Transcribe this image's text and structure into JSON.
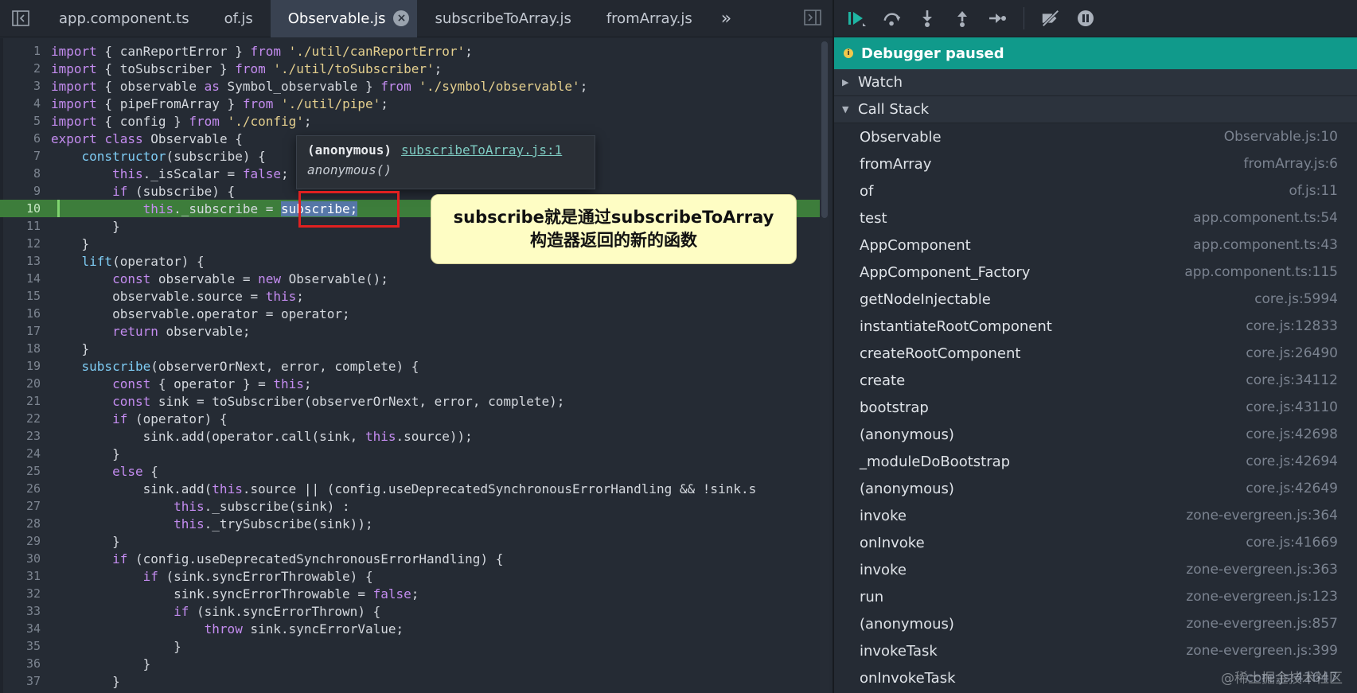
{
  "tabs": {
    "items": [
      "app.component.ts",
      "of.js",
      "Observable.js",
      "subscribeToArray.js",
      "fromArray.js"
    ],
    "active_index": 2,
    "close_glyph": "×",
    "more_glyph": "»"
  },
  "code": {
    "paused_line": 10,
    "lines": [
      {
        "n": "1",
        "html": "<span class=\"k\">import</span> { canReportError } <span class=\"k\">from</span> <span class=\"s\">'./util/canReportError'</span>;"
      },
      {
        "n": "2",
        "html": "<span class=\"k\">import</span> { toSubscriber } <span class=\"k\">from</span> <span class=\"s\">'./util/toSubscriber'</span>;"
      },
      {
        "n": "3",
        "html": "<span class=\"k\">import</span> { observable <span class=\"k\">as</span> Symbol_observable } <span class=\"k\">from</span> <span class=\"s\">'./symbol/observable'</span>;"
      },
      {
        "n": "4",
        "html": "<span class=\"k\">import</span> { pipeFromArray } <span class=\"k\">from</span> <span class=\"s\">'./util/pipe'</span>;"
      },
      {
        "n": "5",
        "html": "<span class=\"k\">import</span> { config } <span class=\"k\">from</span> <span class=\"s\">'./config'</span>;"
      },
      {
        "n": "6",
        "html": "<span class=\"k\">export</span> <span class=\"k\">class</span> Observable {"
      },
      {
        "n": "7",
        "html": "    <span class=\"p\">constructor</span>(subscribe) {"
      },
      {
        "n": "8",
        "html": "        <span class=\"k\">this</span>._isScalar = <span class=\"k\">false</span>;"
      },
      {
        "n": "9",
        "html": "        <span class=\"k\">if</span> (subscribe) {"
      },
      {
        "n": "10",
        "html": "            <span class=\"k\">this</span>._subscribe = <span class=\"hl\">subscribe;</span>"
      },
      {
        "n": "11",
        "html": "        }"
      },
      {
        "n": "12",
        "html": "    }"
      },
      {
        "n": "13",
        "html": "    <span class=\"p\">lift</span>(operator) {"
      },
      {
        "n": "14",
        "html": "        <span class=\"k\">const</span> observable = <span class=\"k\">new</span> Observable();"
      },
      {
        "n": "15",
        "html": "        observable.source = <span class=\"k\">this</span>;"
      },
      {
        "n": "16",
        "html": "        observable.operator = operator;"
      },
      {
        "n": "17",
        "html": "        <span class=\"k\">return</span> observable;"
      },
      {
        "n": "18",
        "html": "    }"
      },
      {
        "n": "19",
        "html": "    <span class=\"p\">subscribe</span>(observerOrNext, error, complete) {"
      },
      {
        "n": "20",
        "html": "        <span class=\"k\">const</span> { operator } = <span class=\"k\">this</span>;"
      },
      {
        "n": "21",
        "html": "        <span class=\"k\">const</span> sink = toSubscriber(observerOrNext, error, complete);"
      },
      {
        "n": "22",
        "html": "        <span class=\"k\">if</span> (operator) {"
      },
      {
        "n": "23",
        "html": "            sink.add(operator.call(sink, <span class=\"k\">this</span>.source));"
      },
      {
        "n": "24",
        "html": "        }"
      },
      {
        "n": "25",
        "html": "        <span class=\"k\">else</span> {"
      },
      {
        "n": "26",
        "html": "            sink.add(<span class=\"k\">this</span>.source || (config.useDeprecatedSynchronousErrorHandling &amp;&amp; !sink.s"
      },
      {
        "n": "27",
        "html": "                <span class=\"k\">this</span>._subscribe(sink) :"
      },
      {
        "n": "28",
        "html": "                <span class=\"k\">this</span>._trySubscribe(sink));"
      },
      {
        "n": "29",
        "html": "        }"
      },
      {
        "n": "30",
        "html": "        <span class=\"k\">if</span> (config.useDeprecatedSynchronousErrorHandling) {"
      },
      {
        "n": "31",
        "html": "            <span class=\"k\">if</span> (sink.syncErrorThrowable) {"
      },
      {
        "n": "32",
        "html": "                sink.syncErrorThrowable = <span class=\"k\">false</span>;"
      },
      {
        "n": "33",
        "html": "                <span class=\"k\">if</span> (sink.syncErrorThrown) {"
      },
      {
        "n": "34",
        "html": "                    <span class=\"k\">throw</span> sink.syncErrorValue;"
      },
      {
        "n": "35",
        "html": "                }"
      },
      {
        "n": "36",
        "html": "            }"
      },
      {
        "n": "37",
        "html": "        }"
      }
    ]
  },
  "tooltip": {
    "function_name": "(anonymous)",
    "location": "subscribeToArray.js:1",
    "signature": "anonymous()"
  },
  "annotation": {
    "line1": "subscribe就是通过subscribeToArray",
    "line2": "构造器返回的新的函数"
  },
  "debugger": {
    "status": "Debugger paused",
    "watch_label": "Watch",
    "callstack_label": "Call Stack",
    "frames": [
      {
        "fn": "Observable",
        "loc": "Observable.js:10"
      },
      {
        "fn": "fromArray",
        "loc": "fromArray.js:6"
      },
      {
        "fn": "of",
        "loc": "of.js:11"
      },
      {
        "fn": "test",
        "loc": "app.component.ts:54"
      },
      {
        "fn": "AppComponent",
        "loc": "app.component.ts:43"
      },
      {
        "fn": "AppComponent_Factory",
        "loc": "app.component.ts:115"
      },
      {
        "fn": "getNodeInjectable",
        "loc": "core.js:5994"
      },
      {
        "fn": "instantiateRootComponent",
        "loc": "core.js:12833"
      },
      {
        "fn": "createRootComponent",
        "loc": "core.js:26490"
      },
      {
        "fn": "create",
        "loc": "core.js:34112"
      },
      {
        "fn": "bootstrap",
        "loc": "core.js:43110"
      },
      {
        "fn": "(anonymous)",
        "loc": "core.js:42698"
      },
      {
        "fn": "_moduleDoBootstrap",
        "loc": "core.js:42694"
      },
      {
        "fn": "(anonymous)",
        "loc": "core.js:42649"
      },
      {
        "fn": "invoke",
        "loc": "zone-evergreen.js:364"
      },
      {
        "fn": "onInvoke",
        "loc": "core.js:41669"
      },
      {
        "fn": "invoke",
        "loc": "zone-evergreen.js:363"
      },
      {
        "fn": "run",
        "loc": "zone-evergreen.js:123"
      },
      {
        "fn": "(anonymous)",
        "loc": "zone-evergreen.js:857"
      },
      {
        "fn": "invokeTask",
        "loc": "zone-evergreen.js:399"
      },
      {
        "fn": "onInvokeTask",
        "loc": "core.js:41647"
      }
    ]
  },
  "watermark": "@稀土掘金技术社区",
  "colors": {
    "accent": "#109a8b",
    "paused_line": "#3d7d3b",
    "keyword": "#c48cf0",
    "string": "#e4cf8e",
    "annotation_bg": "#fefdc4",
    "highlight_box": "#e02020"
  },
  "icons": {
    "toolbar": [
      "resume-icon",
      "step-over-icon",
      "step-into-icon",
      "step-out-icon",
      "step-icon",
      "deactivate-breakpoints-icon",
      "pause-on-exceptions-icon"
    ]
  }
}
